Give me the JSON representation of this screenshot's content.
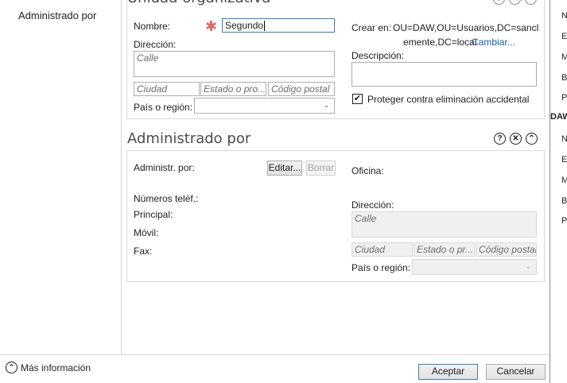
{
  "nav": {
    "items": [
      {
        "label": "Administrado por"
      }
    ]
  },
  "ou_section": {
    "title": "Unidad organizativa",
    "name_label": "Nombre:",
    "name_value": "Segundo",
    "address_label": "Dirección:",
    "street_placeholder": "Calle",
    "city_placeholder": "Ciudad",
    "state_placeholder": "Estado o pro...",
    "postal_placeholder": "Código postal",
    "country_label": "País o región:",
    "create_in_label": "Crear en:",
    "create_in_line1": "OU=DAW,OU=Usuarios,DC=sancl",
    "create_in_line2": "emente,DC=local",
    "change_link": "Cambiar...",
    "description_label": "Descripción:",
    "protect_label": "Proteger contra eliminación accidental",
    "protect_checked": true
  },
  "managed_section": {
    "title": "Administrado por",
    "managed_by_label": "Administr. por:",
    "edit_button": "Editar...",
    "clear_button": "Borrar",
    "office_label": "Oficina:",
    "phones_label": "Números teléf.:",
    "main_label": "Principal:",
    "mobile_label": "Móvil:",
    "fax_label": "Fax:",
    "address_label": "Dirección:",
    "street_placeholder": "Calle",
    "city_placeholder": "Ciudad",
    "state_placeholder": "Estado o pr...",
    "postal_placeholder": "Código postal",
    "country_label": "País o región:"
  },
  "footer": {
    "more_info": "Más información",
    "ok_button": "Aceptar",
    "cancel_button": "Cancelar"
  },
  "right_strip": {
    "letters": [
      "N",
      "El",
      "M",
      "Bo",
      "Pr",
      "DAW",
      "N",
      "El",
      "M",
      "Bo",
      "Pr"
    ]
  },
  "icons": {
    "help": "?",
    "close": "✕",
    "collapse": "⌃",
    "required": "✱",
    "checkmark": "✔",
    "dropdown": "⌄"
  }
}
